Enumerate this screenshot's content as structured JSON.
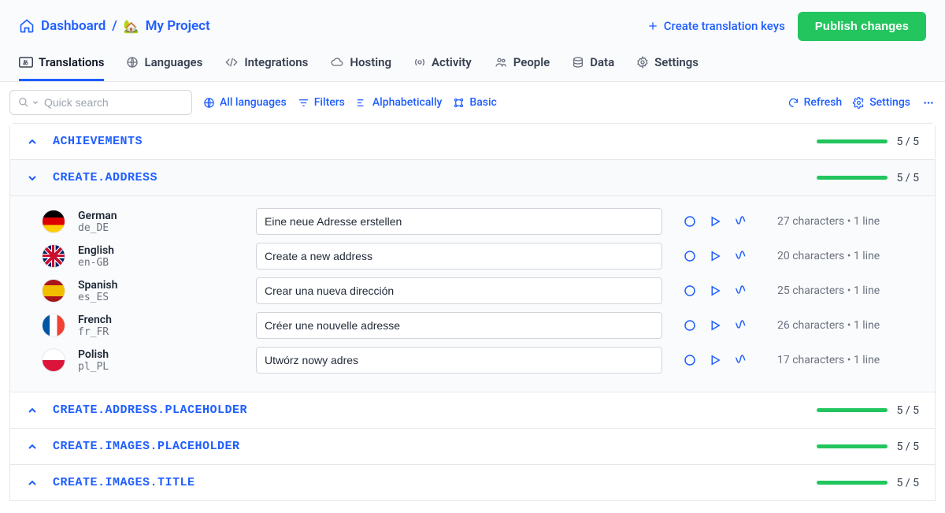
{
  "header": {
    "dashboard": "Dashboard",
    "project_emoji": "🏡",
    "project": "My Project",
    "create_keys": "Create translation keys",
    "publish": "Publish changes"
  },
  "tabs": [
    {
      "label": "Translations",
      "active": true,
      "icon": "translate"
    },
    {
      "label": "Languages",
      "active": false,
      "icon": "globe"
    },
    {
      "label": "Integrations",
      "active": false,
      "icon": "code"
    },
    {
      "label": "Hosting",
      "active": false,
      "icon": "cloud"
    },
    {
      "label": "Activity",
      "active": false,
      "icon": "activity"
    },
    {
      "label": "People",
      "active": false,
      "icon": "people"
    },
    {
      "label": "Data",
      "active": false,
      "icon": "data"
    },
    {
      "label": "Settings",
      "active": false,
      "icon": "gear"
    }
  ],
  "toolbar": {
    "search_placeholder": "Quick search",
    "all_languages": "All languages",
    "filters": "Filters",
    "alpha": "Alphabetically",
    "basic": "Basic",
    "refresh": "Refresh",
    "settings": "Settings"
  },
  "groups": [
    {
      "key": "ACHIEVEMENTS",
      "count": "5 / 5",
      "expanded": false
    },
    {
      "key": "CREATE.ADDRESS",
      "count": "5 / 5",
      "expanded": true,
      "rows": [
        {
          "lang": "German",
          "code": "de_DE",
          "flag": "de",
          "text": "Eine neue Adresse erstellen",
          "meta": "27 characters • 1 line"
        },
        {
          "lang": "English",
          "code": "en-GB",
          "flag": "en",
          "text": "Create a new address",
          "meta": "20 characters • 1 line"
        },
        {
          "lang": "Spanish",
          "code": "es_ES",
          "flag": "es",
          "text": "Crear una nueva dirección",
          "meta": "25 characters • 1 line"
        },
        {
          "lang": "French",
          "code": "fr_FR",
          "flag": "fr",
          "text": "Créer une nouvelle adresse",
          "meta": "26 characters • 1 line"
        },
        {
          "lang": "Polish",
          "code": "pl_PL",
          "flag": "pl",
          "text": "Utwórz nowy adres",
          "meta": "17 characters • 1 line"
        }
      ]
    },
    {
      "key": "CREATE.ADDRESS.PLACEHOLDER",
      "count": "5 / 5",
      "expanded": false
    },
    {
      "key": "CREATE.IMAGES.PLACEHOLDER",
      "count": "5 / 5",
      "expanded": false
    },
    {
      "key": "CREATE.IMAGES.TITLE",
      "count": "5 / 5",
      "expanded": false
    }
  ]
}
